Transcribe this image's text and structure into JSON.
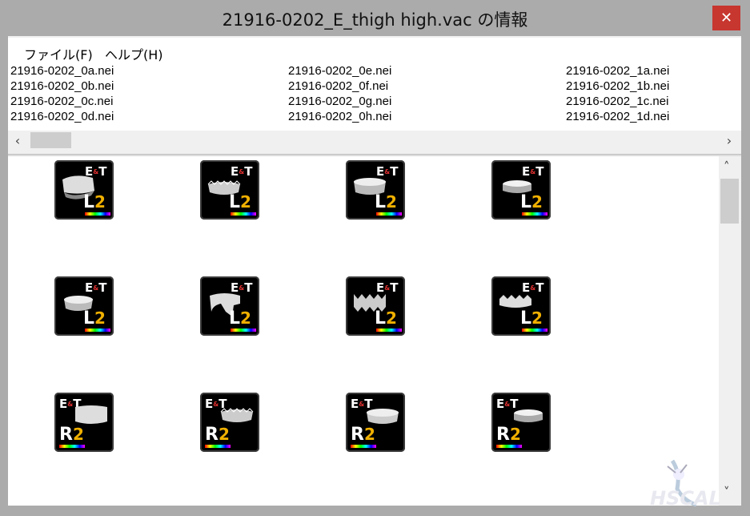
{
  "window": {
    "title": "21916-0202_E_thigh high.vac の情報",
    "close_icon": "close-icon"
  },
  "menu": [
    {
      "label": "ファイル(F)"
    },
    {
      "label": "ヘルプ(H)"
    }
  ],
  "files": {
    "col1": [
      "21916-0202_0a.nei",
      "21916-0202_0b.nei",
      "21916-0202_0c.nei",
      "21916-0202_0d.nei"
    ],
    "col2": [
      "21916-0202_0e.nei",
      "21916-0202_0f.nei",
      "21916-0202_0g.nei",
      "21916-0202_0h.nei"
    ],
    "col3": [
      "21916-0202_1a.nei",
      "21916-0202_1b.nei",
      "21916-0202_1c.nei",
      "21916-0202_1d.nei"
    ]
  },
  "tiles": {
    "row1": [
      {
        "side": "L",
        "num": "2"
      },
      {
        "side": "L",
        "num": "2"
      },
      {
        "side": "L",
        "num": "2"
      },
      {
        "side": "L",
        "num": "2"
      }
    ],
    "row2": [
      {
        "side": "L",
        "num": "2"
      },
      {
        "side": "L",
        "num": "2"
      },
      {
        "side": "L",
        "num": "2"
      },
      {
        "side": "L",
        "num": "2"
      }
    ],
    "row3": [
      {
        "side": "R",
        "num": "2"
      },
      {
        "side": "R",
        "num": "2"
      },
      {
        "side": "R",
        "num": "2"
      },
      {
        "side": "R",
        "num": "2"
      }
    ],
    "badge_left": "E",
    "badge_amp": "&",
    "badge_right": "T"
  },
  "colors": {
    "close": "#c7362f",
    "tile_bg": "#000000",
    "accent_num": "#f0b000"
  },
  "watermark": {
    "text": "HSCAL"
  }
}
